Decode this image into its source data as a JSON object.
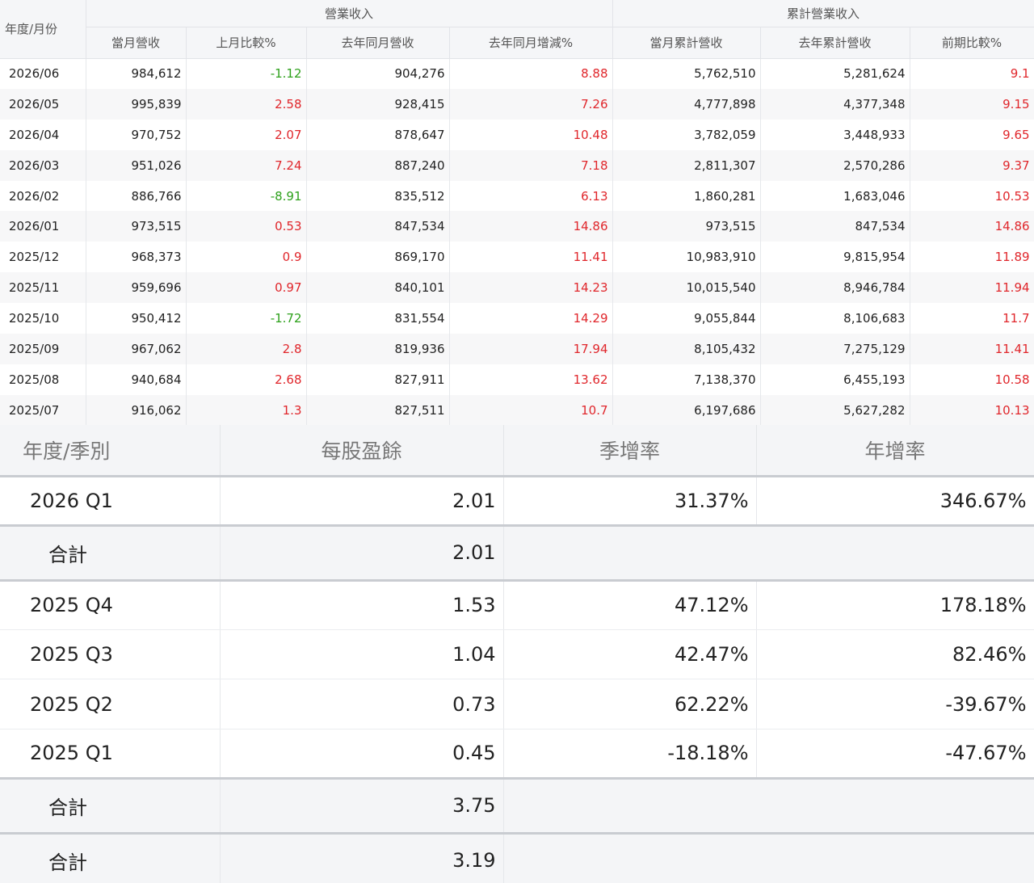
{
  "revenue": {
    "corner_label": "年度/月份",
    "group_headers": [
      "營業收入",
      "累計營業收入"
    ],
    "column_headers": [
      "當月營收",
      "上月比較%",
      "去年同月營收",
      "去年同月增減%",
      "當月累計營收",
      "去年累計營收",
      "前期比較%"
    ],
    "colors": {
      "positive": "#e0262b",
      "negative": "#2ea11c"
    },
    "rows": [
      [
        "2026/06",
        "984,612",
        "-1.12",
        "904,276",
        "8.88",
        "5,762,510",
        "5,281,624",
        "9.1"
      ],
      [
        "2026/05",
        "995,839",
        "2.58",
        "928,415",
        "7.26",
        "4,777,898",
        "4,377,348",
        "9.15"
      ],
      [
        "2026/04",
        "970,752",
        "2.07",
        "878,647",
        "10.48",
        "3,782,059",
        "3,448,933",
        "9.65"
      ],
      [
        "2026/03",
        "951,026",
        "7.24",
        "887,240",
        "7.18",
        "2,811,307",
        "2,570,286",
        "9.37"
      ],
      [
        "2026/02",
        "886,766",
        "-8.91",
        "835,512",
        "6.13",
        "1,860,281",
        "1,683,046",
        "10.53"
      ],
      [
        "2026/01",
        "973,515",
        "0.53",
        "847,534",
        "14.86",
        "973,515",
        "847,534",
        "14.86"
      ],
      [
        "2025/12",
        "968,373",
        "0.9",
        "869,170",
        "11.41",
        "10,983,910",
        "9,815,954",
        "11.89"
      ],
      [
        "2025/11",
        "959,696",
        "0.97",
        "840,101",
        "14.23",
        "10,015,540",
        "8,946,784",
        "11.94"
      ],
      [
        "2025/10",
        "950,412",
        "-1.72",
        "831,554",
        "14.29",
        "9,055,844",
        "8,106,683",
        "11.7"
      ],
      [
        "2025/09",
        "967,062",
        "2.8",
        "819,936",
        "17.94",
        "8,105,432",
        "7,275,129",
        "11.41"
      ],
      [
        "2025/08",
        "940,684",
        "2.68",
        "827,911",
        "13.62",
        "7,138,370",
        "6,455,193",
        "10.58"
      ],
      [
        "2025/07",
        "916,062",
        "1.3",
        "827,511",
        "10.7",
        "6,197,686",
        "5,627,282",
        "10.13"
      ]
    ]
  },
  "eps": {
    "headers": [
      "年度/季別",
      "每股盈餘",
      "季增率",
      "年增率"
    ],
    "rows": [
      {
        "type": "row",
        "cells": [
          "2026 Q1",
          "2.01",
          "31.37%",
          "346.67%"
        ]
      },
      {
        "type": "total",
        "cells": [
          "合計",
          "2.01"
        ]
      },
      {
        "type": "row",
        "cells": [
          "2025 Q4",
          "1.53",
          "47.12%",
          "178.18%"
        ]
      },
      {
        "type": "row",
        "cells": [
          "2025 Q3",
          "1.04",
          "42.47%",
          "82.46%"
        ]
      },
      {
        "type": "row",
        "cells": [
          "2025 Q2",
          "0.73",
          "62.22%",
          "-39.67%"
        ]
      },
      {
        "type": "row",
        "cells": [
          "2025 Q1",
          "0.45",
          "-18.18%",
          "-47.67%"
        ]
      },
      {
        "type": "total",
        "cells": [
          "合計",
          "3.75"
        ]
      },
      {
        "type": "total",
        "cells": [
          "合計",
          "3.19"
        ]
      }
    ]
  }
}
